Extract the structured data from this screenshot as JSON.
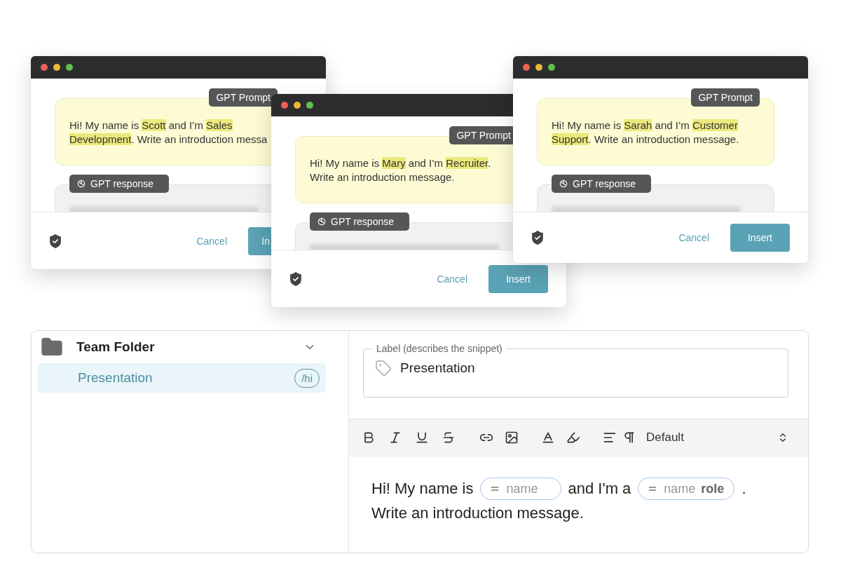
{
  "windows": [
    {
      "prompt_badge": "GPT Prompt",
      "prompt": [
        {
          "text": "Hi! My name is ",
          "highlighted": false
        },
        {
          "text": "Scott",
          "highlighted": true
        },
        {
          "text": " and I’m ",
          "highlighted": false
        },
        {
          "text": "Sales Development",
          "highlighted": true
        },
        {
          "text": ". Write an introduction messa",
          "highlighted": false
        }
      ],
      "response_badge": "GPT response",
      "cancel": "Cancel",
      "insert": "In"
    },
    {
      "prompt_badge": "GPT Prompt",
      "prompt": [
        {
          "text": "Hi! My name is ",
          "highlighted": false
        },
        {
          "text": "Mary",
          "highlighted": true
        },
        {
          "text": " and I’m ",
          "highlighted": false
        },
        {
          "text": "Recruiter",
          "highlighted": true
        },
        {
          "text": ". Write an introduction message.",
          "highlighted": false
        }
      ],
      "response_badge": "GPT response",
      "cancel": "Cancel",
      "insert": "Insert"
    },
    {
      "prompt_badge": "GPT Prompt",
      "prompt": [
        {
          "text": "Hi! My name is ",
          "highlighted": false
        },
        {
          "text": "Sarah",
          "highlighted": true
        },
        {
          "text": " and I’m ",
          "highlighted": false
        },
        {
          "text": "Customer Support",
          "highlighted": true
        },
        {
          "text": ". Write an introduction message.",
          "highlighted": false
        }
      ],
      "response_badge": "GPT response",
      "cancel": "Cancel",
      "insert": "Insert"
    }
  ],
  "snippet_editor": {
    "folder": {
      "name": "Team Folder",
      "expanded": true,
      "children": [
        {
          "label": "Presentation",
          "shortcut": "/hi",
          "selected": true
        }
      ]
    },
    "label_field": {
      "legend": "Label (describes the snippet)",
      "value": "Presentation"
    },
    "toolbar": {
      "style_select": "Default"
    },
    "body": {
      "lines": [
        [
          {
            "kind": "text",
            "text": "Hi! My name is"
          },
          {
            "kind": "variable",
            "label": "name"
          },
          {
            "kind": "text",
            "text": "and I'm a"
          },
          {
            "kind": "variable",
            "label": "name",
            "value": "role"
          },
          {
            "kind": "text",
            "text": "."
          }
        ],
        [
          {
            "kind": "text",
            "text": "Write an introduction message."
          }
        ]
      ]
    }
  }
}
